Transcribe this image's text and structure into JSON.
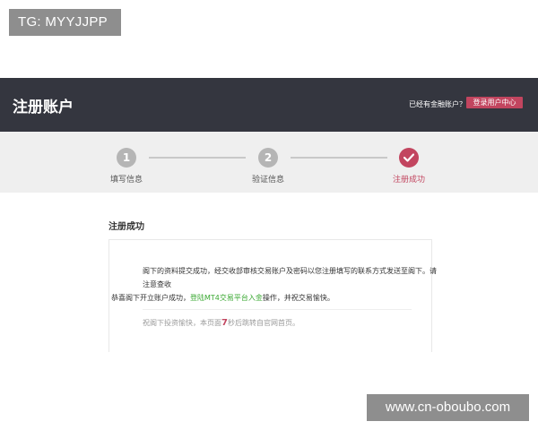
{
  "overlay": {
    "tg_text": "TG: MYYJJPP",
    "watermark_text": "www.cn-oboubo.com"
  },
  "header": {
    "title": "注册账户",
    "login_prompt": "已经有金融账户？",
    "login_button": "登录用户中心"
  },
  "steps": [
    {
      "number": "1",
      "label": "填写信息",
      "status": "completed"
    },
    {
      "number": "2",
      "label": "验证信息",
      "status": "completed"
    },
    {
      "number": "",
      "label": "注册成功",
      "status": "current",
      "icon": "check-icon"
    }
  ],
  "success": {
    "title": "注册成功",
    "line1": "阁下的资料提交成功，经交收部审核交易账户及密码以您注册填写的联系方式发送至阁下。请",
    "line2": "注意查收",
    "line3_prefix": "恭喜阁下开立账户成功，",
    "line3_link": "登陆MT4交易平台入金",
    "line3_suffix": "操作，并祝交易愉快。",
    "line4_prefix": "祝阁下投资愉快，本页面",
    "line4_count": "7",
    "line4_suffix": "秒后跳转自官网首页。"
  },
  "colors": {
    "header_bg": "#34363f",
    "accent": "#c2455f",
    "link_green": "#3aa832",
    "step_inactive": "#b5b5b5"
  }
}
